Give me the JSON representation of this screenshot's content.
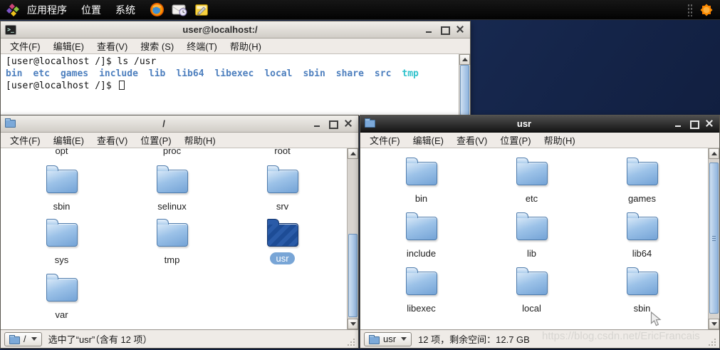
{
  "colors": {
    "desktop_navy": "#182a52",
    "selection_pill_blue": "#78a5d6",
    "terminal_dir_blue": "#4d7fbe",
    "terminal_tmp_cyan": "#2fc2cc",
    "active_titlebar": "#2a2a2a"
  },
  "panel": {
    "menus": [
      "应用程序",
      "位置",
      "系统"
    ],
    "launcher_icons": [
      "firefox-icon",
      "evolution-mail-icon",
      "notes-icon"
    ],
    "tray_icon": "updates-icon"
  },
  "terminal": {
    "title": "user@localhost:/",
    "menus": [
      "文件(F)",
      "编辑(E)",
      "查看(V)",
      "搜索 (S)",
      "终端(T)",
      "帮助(H)"
    ],
    "prompt1": "[user@localhost /]$",
    "command1": "ls /usr",
    "listing": [
      "bin",
      "etc",
      "games",
      "include",
      "lib",
      "lib64",
      "libexec",
      "local",
      "sbin",
      "share",
      "src",
      "tmp"
    ],
    "prompt2": "[user@localhost /]$"
  },
  "root_window": {
    "title": "/",
    "menus": [
      "文件(F)",
      "编辑(E)",
      "查看(V)",
      "位置(P)",
      "帮助(H)"
    ],
    "partial_labels": [
      "opt",
      "proc",
      "root"
    ],
    "rows": [
      [
        "sbin",
        "selinux",
        "srv"
      ],
      [
        "sys",
        "tmp",
        "usr"
      ],
      [
        "var"
      ]
    ],
    "selected_item": "usr",
    "statusbar": {
      "location": "/",
      "text": "选中了“usr”（含有 12 项）"
    }
  },
  "usr_window": {
    "title": "usr",
    "menus": [
      "文件(F)",
      "编辑(E)",
      "查看(V)",
      "位置(P)",
      "帮助(H)"
    ],
    "rows": [
      [
        "bin",
        "etc",
        "games"
      ],
      [
        "include",
        "lib",
        "lib64"
      ],
      [
        "libexec",
        "local",
        "sbin"
      ]
    ],
    "statusbar": {
      "location": "usr",
      "text": "12 项，剩余空间：12.7 GB"
    }
  },
  "watermark": "https://blog.csdn.net/EricFrancais"
}
